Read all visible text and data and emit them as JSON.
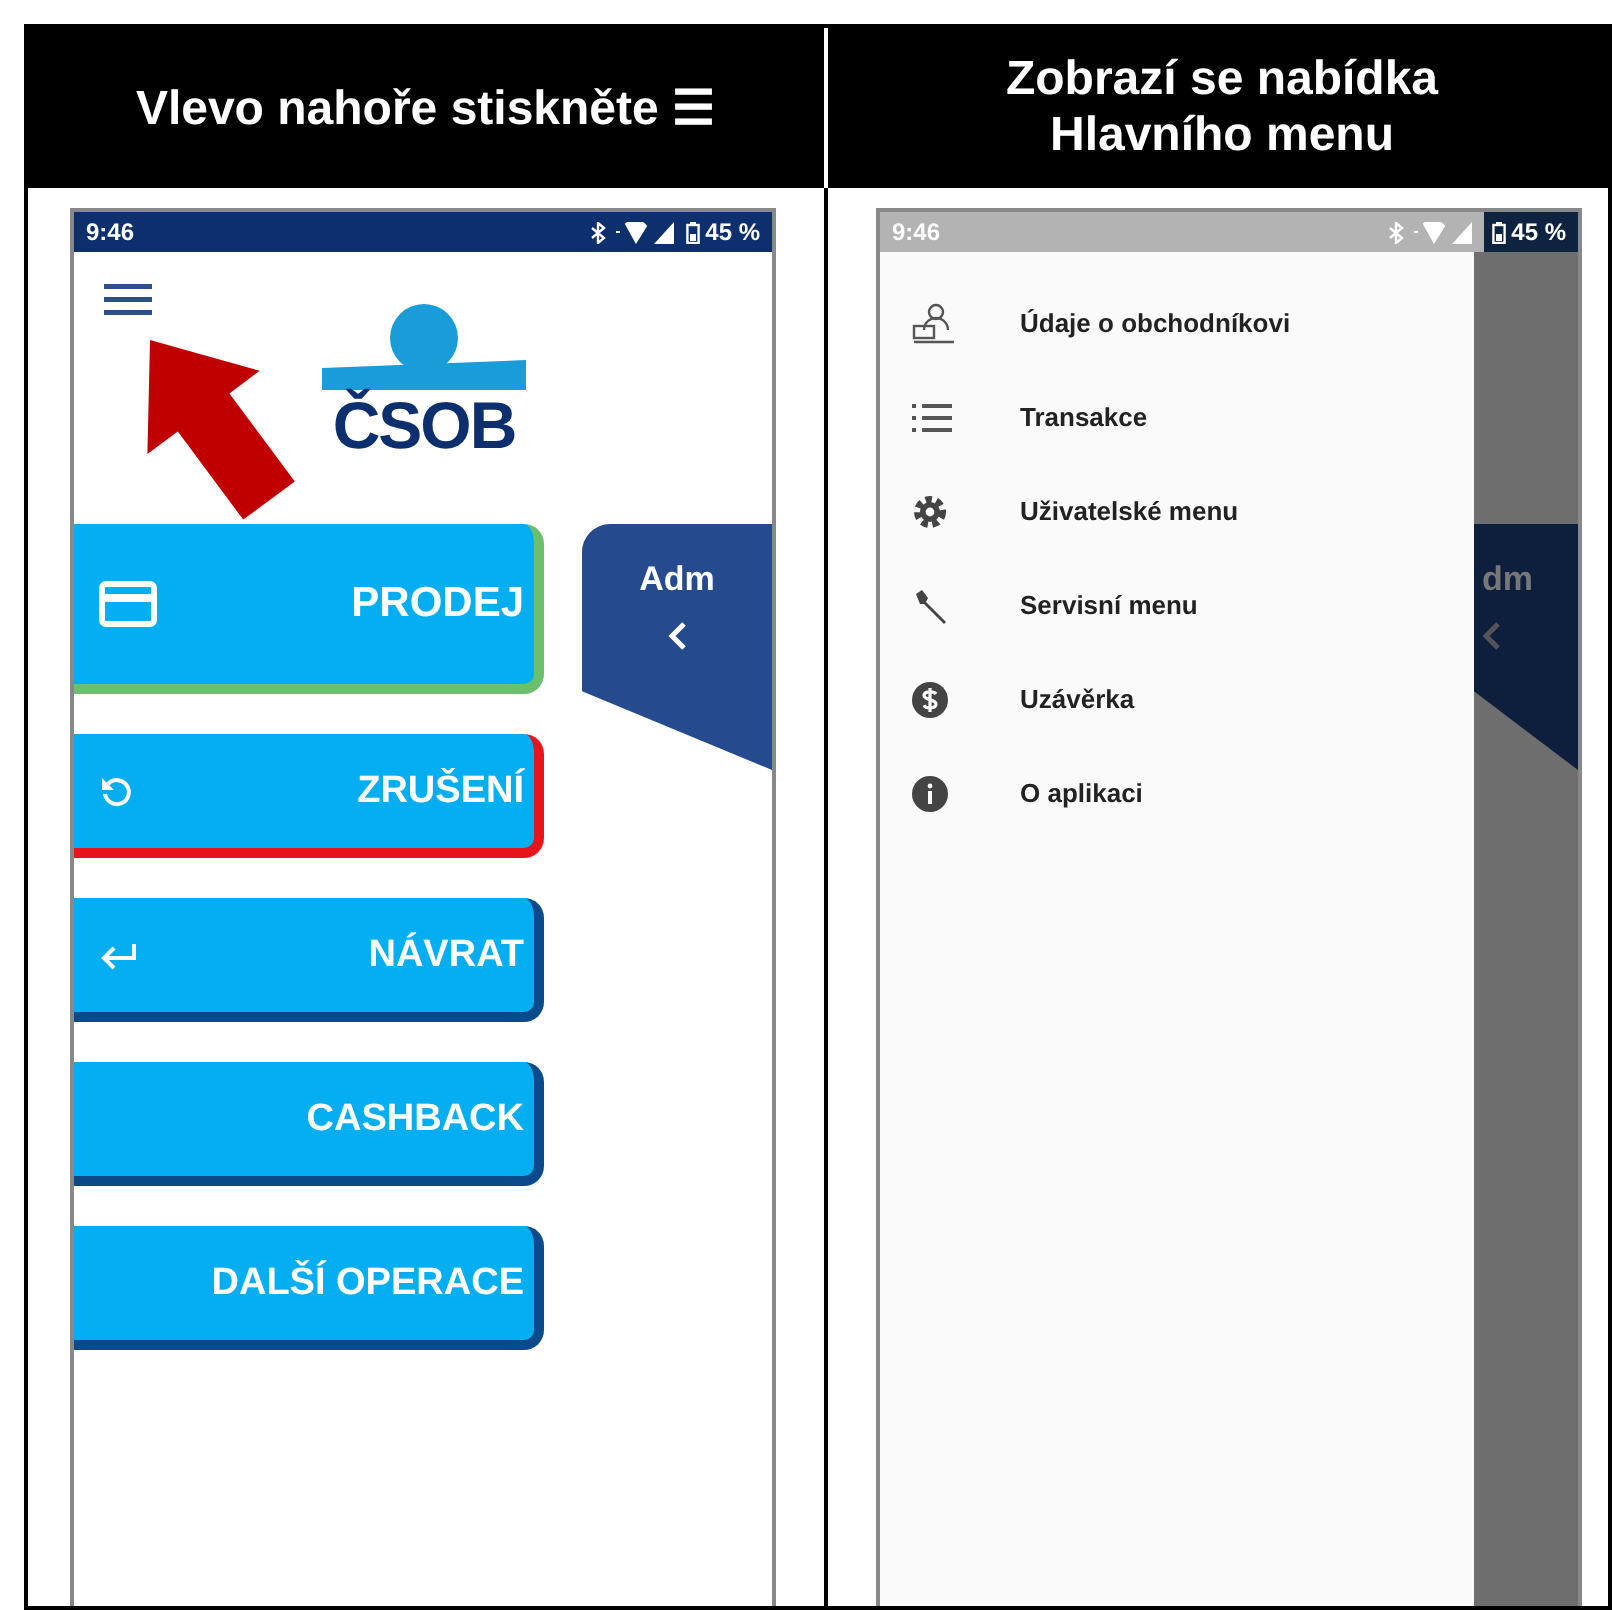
{
  "headers": [
    "Vlevo nahoře stiskněte ☰",
    "Zobrazí se nabídka Hlavního menu"
  ],
  "main_screen": {
    "status_bar": {
      "time": "9:46",
      "battery": "45 %"
    },
    "logo_text": "ČSOB",
    "buttons": [
      {
        "label": "PRODEJ",
        "kind": "card",
        "color": "#6cbf6c"
      },
      {
        "label": "ZRUŠENÍ",
        "kind": "undo",
        "color": "#e8141c"
      },
      {
        "label": "NÁVRAT",
        "kind": "return",
        "color": "#0b4a8a"
      },
      {
        "label": "CASHBACK",
        "kind": "plain",
        "color": "#0b4a8a"
      },
      {
        "label": "DALŠÍ OPERACE",
        "kind": "plain",
        "color": "#0b4a8a"
      }
    ],
    "side_tab": {
      "label": "Adm"
    }
  },
  "menu_screen": {
    "status_bar": {
      "time": "9:46",
      "battery": "45 %"
    },
    "menu_items": [
      {
        "label": "Údaje o obchodníkovi",
        "kind": "merchant"
      },
      {
        "label": "Transakce",
        "kind": "list"
      },
      {
        "label": "Uživatelské menu",
        "kind": "gear"
      },
      {
        "label": "Servisní menu",
        "kind": "wrench"
      },
      {
        "label": "Uzávěrka",
        "kind": "dollar"
      },
      {
        "label": "O aplikaci",
        "kind": "info"
      }
    ],
    "side_tab": {
      "label": "dm"
    }
  }
}
